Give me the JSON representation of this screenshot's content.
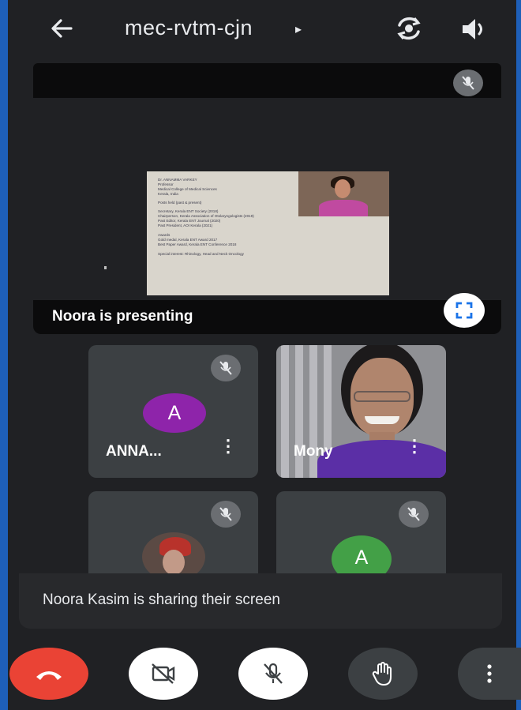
{
  "meeting": {
    "code": "mec-rvtm-cjn",
    "caret": "▸"
  },
  "topbar": {
    "back_icon": "arrow-left-icon",
    "switch_camera_icon": "switch-camera-icon",
    "volume_icon": "speaker-icon"
  },
  "presentation": {
    "label": "Noora is presenting",
    "fullscreen_icon": "fullscreen-icon"
  },
  "participants": [
    {
      "name": "ANNA...",
      "avatar_letter": "A",
      "avatar_color": "#8e24aa",
      "muted": true
    },
    {
      "name": "Mony",
      "muted": false
    },
    {
      "name": "",
      "muted": true
    },
    {
      "name": "",
      "avatar_letter": "A",
      "avatar_color": "#43a047",
      "muted": true
    }
  ],
  "share_banner": {
    "text": "Noora Kasim is sharing their screen"
  },
  "controls": {
    "end_call_icon": "hang-up-icon",
    "camera_icon": "camera-off-icon",
    "mic_icon": "mic-off-icon",
    "raise_hand_icon": "raise-hand-icon",
    "more_icon": "more-vert-icon",
    "end_call_color": "#ea4335"
  },
  "more_glyph": "⋮"
}
